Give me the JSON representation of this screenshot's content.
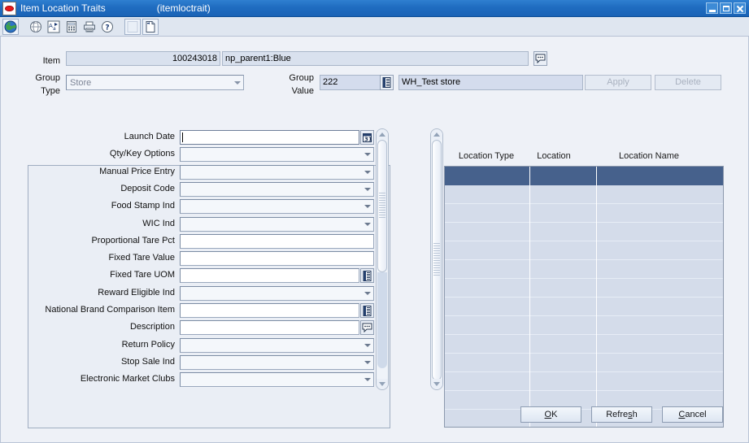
{
  "window": {
    "title": "Item Location Traits",
    "subtitle": "(itemloctrait)",
    "app_icon": "oracle-forms-icon",
    "minimize_label": "Minimize",
    "maximize_label": "Maximize",
    "close_label": "Close"
  },
  "toolbar": {
    "buttons": [
      {
        "name": "globe-icon",
        "tooltip": "Action"
      },
      {
        "name": "globe-gray-icon",
        "tooltip": "Previous"
      },
      {
        "name": "spellcheck-icon",
        "tooltip": "Translate"
      },
      {
        "name": "calculator-icon",
        "tooltip": "Calculator"
      },
      {
        "name": "printer-icon",
        "tooltip": "Print"
      },
      {
        "name": "help-icon",
        "tooltip": "Help"
      },
      {
        "name": "blank-page-icon",
        "tooltip": "Blank"
      },
      {
        "name": "new-page-icon",
        "tooltip": "New"
      }
    ]
  },
  "header": {
    "item_label": "Item",
    "item_number": "100243018",
    "item_description": "np_parent1:Blue",
    "item_comment_icon": "comment-icon",
    "group_type_label_line1": "Group",
    "group_type_label_line2": "Type",
    "group_type_value": "Store",
    "group_value_label_line1": "Group",
    "group_value_label_line2": "Value",
    "group_value_code": "222",
    "group_value_lov_icon": "list-of-values-icon",
    "group_value_name": "WH_Test store",
    "apply_label": "Apply",
    "apply_enabled": false,
    "delete_label": "Delete",
    "delete_enabled": false
  },
  "form": {
    "fields": [
      {
        "label": "Launch Date",
        "type": "date",
        "value": "",
        "icon": "calendar-icon",
        "focused": true
      },
      {
        "label": "Qty/Key Options",
        "type": "combo",
        "value": "",
        "icon": "chevron-down-icon",
        "focused": false
      },
      {
        "label": "Manual Price Entry",
        "type": "combo",
        "value": "",
        "icon": "chevron-down-icon",
        "focused": false
      },
      {
        "label": "Deposit Code",
        "type": "combo",
        "value": "",
        "icon": "chevron-down-icon",
        "focused": false
      },
      {
        "label": "Food Stamp Ind",
        "type": "combo",
        "value": "",
        "icon": "chevron-down-icon",
        "focused": false
      },
      {
        "label": "WIC Ind",
        "type": "combo",
        "value": "",
        "icon": "chevron-down-icon",
        "focused": false
      },
      {
        "label": "Proportional Tare Pct",
        "type": "text",
        "value": "",
        "icon": "",
        "focused": false
      },
      {
        "label": "Fixed Tare Value",
        "type": "text",
        "value": "",
        "icon": "",
        "focused": false
      },
      {
        "label": "Fixed Tare UOM",
        "type": "lov",
        "value": "",
        "icon": "list-of-values-icon",
        "focused": false
      },
      {
        "label": "Reward Eligible Ind",
        "type": "combo",
        "value": "",
        "icon": "chevron-down-icon",
        "focused": false
      },
      {
        "label": "National Brand Comparison Item",
        "type": "lov",
        "value": "",
        "icon": "list-of-values-icon",
        "focused": false
      },
      {
        "label": "Description",
        "type": "lov",
        "value": "",
        "icon": "comment-icon",
        "focused": false
      },
      {
        "label": "Return Policy",
        "type": "combo",
        "value": "",
        "icon": "chevron-down-icon",
        "focused": false
      },
      {
        "label": "Stop Sale Ind",
        "type": "combo",
        "value": "",
        "icon": "chevron-down-icon",
        "focused": false
      },
      {
        "label": "Electronic Market Clubs",
        "type": "combo",
        "value": "",
        "icon": "chevron-down-icon",
        "focused": false
      }
    ]
  },
  "table": {
    "columns": [
      {
        "label": "Location Type"
      },
      {
        "label": "Location"
      },
      {
        "label": "Location Name"
      }
    ],
    "rows": [
      {
        "location_type": "",
        "location": "",
        "location_name": "",
        "selected": true
      },
      {
        "location_type": "",
        "location": "",
        "location_name": "",
        "selected": false
      },
      {
        "location_type": "",
        "location": "",
        "location_name": "",
        "selected": false
      },
      {
        "location_type": "",
        "location": "",
        "location_name": "",
        "selected": false
      },
      {
        "location_type": "",
        "location": "",
        "location_name": "",
        "selected": false
      },
      {
        "location_type": "",
        "location": "",
        "location_name": "",
        "selected": false
      },
      {
        "location_type": "",
        "location": "",
        "location_name": "",
        "selected": false
      },
      {
        "location_type": "",
        "location": "",
        "location_name": "",
        "selected": false
      },
      {
        "location_type": "",
        "location": "",
        "location_name": "",
        "selected": false
      },
      {
        "location_type": "",
        "location": "",
        "location_name": "",
        "selected": false
      },
      {
        "location_type": "",
        "location": "",
        "location_name": "",
        "selected": false
      },
      {
        "location_type": "",
        "location": "",
        "location_name": "",
        "selected": false
      },
      {
        "location_type": "",
        "location": "",
        "location_name": "",
        "selected": false
      },
      {
        "location_type": "",
        "location": "",
        "location_name": "",
        "selected": false
      }
    ]
  },
  "footer": {
    "ok": {
      "pre": "",
      "mnemonic": "O",
      "post": "K"
    },
    "refresh": {
      "pre": "Refre",
      "mnemonic": "s",
      "post": "h"
    },
    "cancel": {
      "pre": "",
      "mnemonic": "C",
      "post": "ancel"
    }
  },
  "colors": {
    "titlebar": "#1f6cc0",
    "canvas": "#eef1f7",
    "table_header_row": "#46618c",
    "table_row": "#d4dcea",
    "readonly_field": "#d9e1ee",
    "border": "#9aa8bd"
  }
}
